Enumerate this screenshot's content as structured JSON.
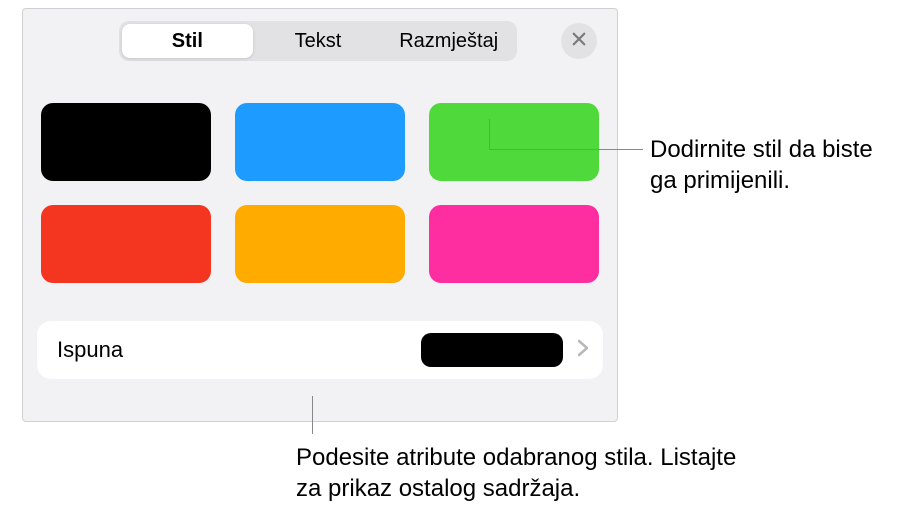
{
  "tabs": {
    "style": "Stil",
    "text": "Tekst",
    "layout": "Razmještaj"
  },
  "swatches": [
    {
      "color": "#000000"
    },
    {
      "color": "#1e9bff"
    },
    {
      "color": "#4fd93a"
    },
    {
      "color": "#f4351f"
    },
    {
      "color": "#ffab00"
    },
    {
      "color": "#ff2ea0"
    }
  ],
  "fill": {
    "label": "Ispuna",
    "preview_color": "#000000"
  },
  "callouts": {
    "apply_style": "Dodirnite stil da biste ga primijenili.",
    "adjust_attrs": "Podesite atribute odabranog stila. Listajte za prikaz ostalog sadržaja."
  }
}
